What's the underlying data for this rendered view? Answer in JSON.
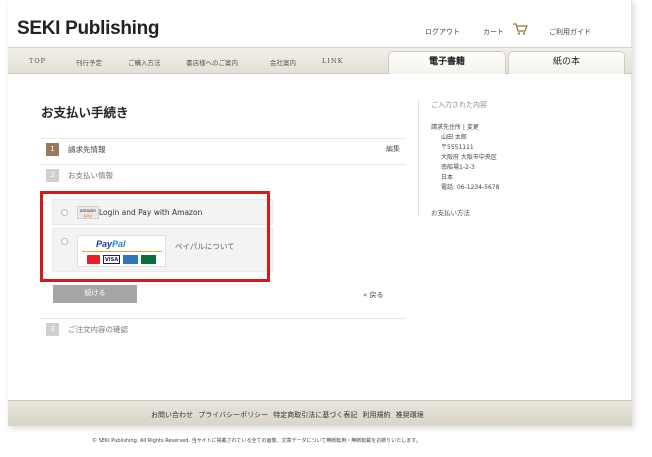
{
  "header": {
    "brand": "SEKI Publishing",
    "logout": "ログアウト",
    "cart": "カート",
    "guide": "ご利用ガイド"
  },
  "nav": {
    "items": [
      "TOP",
      "刊行予定",
      "ご購入方法",
      "書店様へのご案内",
      "会社案内",
      "LINK"
    ],
    "tabs": [
      "電子書籍",
      "紙の本"
    ]
  },
  "main": {
    "title": "お支払い手続き",
    "steps": [
      {
        "num": "1",
        "label": "請求先情報",
        "action": "編集"
      },
      {
        "num": "2",
        "label": "お支払い情報"
      },
      {
        "num": "3",
        "label": "ご注文内容の確認"
      }
    ],
    "payment": {
      "amazon_logo_top": "amazon",
      "amazon_logo_bottom": "pay",
      "amazon_label": "Login and Pay with Amazon",
      "paypal_logo_a": "Pay",
      "paypal_logo_b": "Pal",
      "visa": "VISA",
      "paypal_about": "ペイパルについて"
    },
    "next_button": "続ける",
    "back_link": "« 戻る"
  },
  "sidebar": {
    "heading": "ご入力された内容",
    "billing_label": "請求先住所 | 変更",
    "name": "山田 太郎",
    "zip": "〒5551111",
    "address1": "大阪府 大阪市中央区",
    "address2": "南船場1-2-3",
    "country": "日本",
    "phone": "電話: 06-1234-5678",
    "payment_method": "お支払い方法"
  },
  "footer": {
    "links": "お問い合わせ  プライバシーポリシー  特定商取引法に基づく表記  利用規約  推奨環境",
    "copyright": "© SEKI Publishing. All Rights Reserved. 当サイトに掲載されている全ての画像、文章データについて無断転用・無断転載をお断りいたします。"
  },
  "colors": {
    "highlight": "#d11b1b",
    "step_active": "#9a7a5c",
    "step_inactive": "#cfcfcf"
  }
}
